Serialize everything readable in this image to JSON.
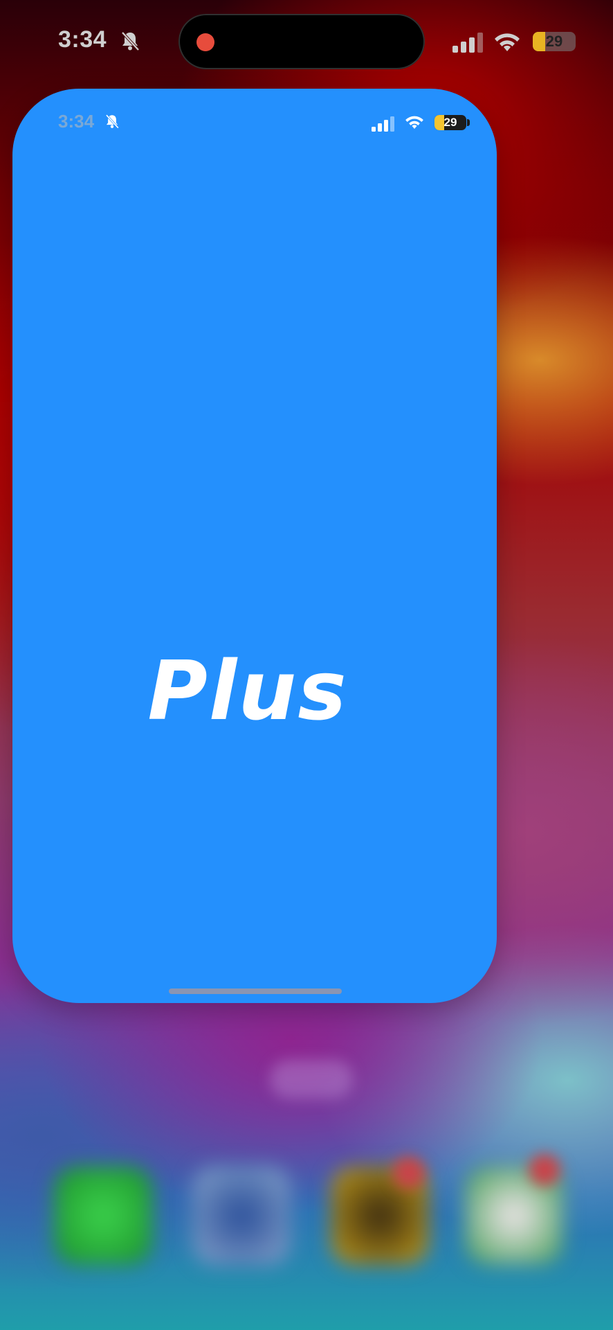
{
  "system_status": {
    "time": "3:34",
    "battery": "29",
    "icons": [
      "bell-slash-icon",
      "cellular-signal-icon",
      "wifi-icon",
      "battery-charging-icon"
    ]
  },
  "dynamic_island": {
    "recording_indicator": "red-dot"
  },
  "app_card": {
    "status": {
      "time": "3:34",
      "battery": "29"
    },
    "title": "Plus",
    "background_color": "#2490fd"
  },
  "dock": {
    "apps": [
      "phone-app-icon",
      "safari-app-icon",
      "photos-app-icon",
      "mail-app-icon"
    ]
  },
  "colors": {
    "accent": "#2490fd",
    "battery_fill": "#f4c430",
    "recording": "#e74c3c"
  }
}
